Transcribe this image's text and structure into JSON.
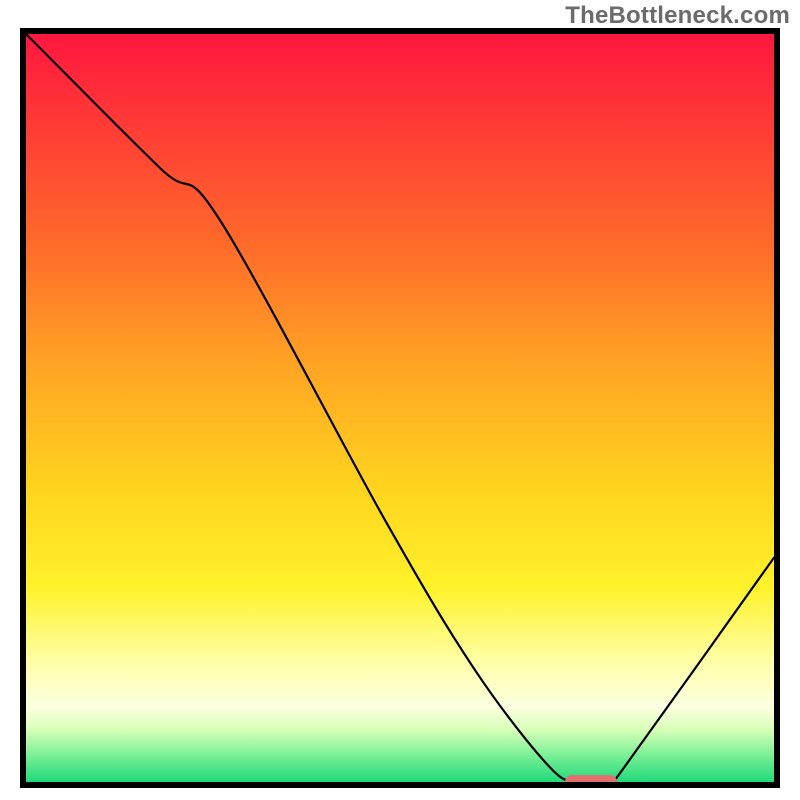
{
  "watermark": "TheBottleneck.com",
  "chart_data": {
    "type": "line",
    "title": "",
    "xlabel": "",
    "ylabel": "",
    "xlim": [
      0,
      100
    ],
    "ylim": [
      0,
      100
    ],
    "grid": false,
    "legend": null,
    "series": [
      {
        "name": "bottleneck-curve",
        "x": [
          0,
          18,
          26,
          48,
          60,
          70,
          74,
          78,
          80,
          100
        ],
        "values": [
          100,
          82,
          75,
          35,
          15,
          2,
          0,
          0,
          2,
          30
        ]
      }
    ],
    "optimum_range_x": [
      72,
      79
    ],
    "background": {
      "type": "vertical-gradient",
      "stops": [
        {
          "offset": 0.0,
          "color": "#ff173f"
        },
        {
          "offset": 0.12,
          "color": "#ff3a36"
        },
        {
          "offset": 0.28,
          "color": "#ff6a2a"
        },
        {
          "offset": 0.44,
          "color": "#ffa324"
        },
        {
          "offset": 0.6,
          "color": "#ffd21e"
        },
        {
          "offset": 0.74,
          "color": "#fff22a"
        },
        {
          "offset": 0.84,
          "color": "#ffffa8"
        },
        {
          "offset": 0.9,
          "color": "#fcffe0"
        },
        {
          "offset": 0.93,
          "color": "#d8ffb8"
        },
        {
          "offset": 0.96,
          "color": "#86f29a"
        },
        {
          "offset": 1.0,
          "color": "#1fd979"
        }
      ]
    }
  }
}
